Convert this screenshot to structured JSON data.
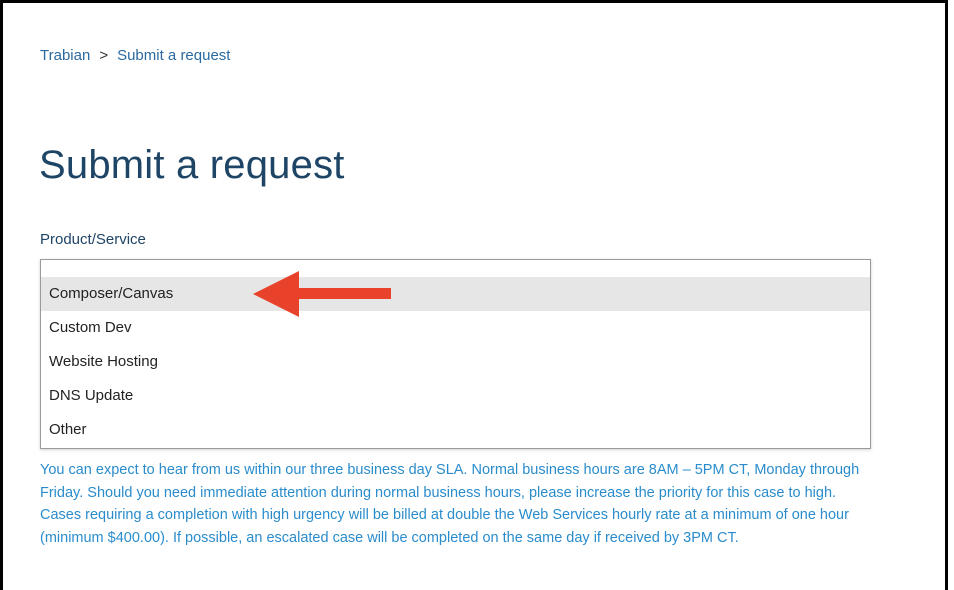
{
  "breadcrumb": {
    "root": "Trabian",
    "separator": ">",
    "current": "Submit a request"
  },
  "page": {
    "title": "Submit a request"
  },
  "form": {
    "product_label": "Product/Service",
    "product_options": [
      "Composer/Canvas",
      "Custom Dev",
      "Website Hosting",
      "DNS Update",
      "Other"
    ],
    "highlighted_option": "Composer/Canvas",
    "help_text": "You can expect to hear from us within our three business day SLA. Normal business hours are 8AM – 5PM CT, Monday through Friday. Should you need immediate attention during normal business hours, please increase the priority for this case to high. Cases requiring a completion with high urgency will be billed at double the Web Services hourly rate at a minimum of one hour (minimum $400.00). If possible, an escalated case will be completed on the same day if received by 3PM CT."
  },
  "annotation": {
    "icon": "red-arrow-icon",
    "color": "#e8432a"
  },
  "colors": {
    "link": "#2a6aa0",
    "title": "#1e4466",
    "help_text": "#2a8ccc",
    "highlight": "#e6e6e6"
  }
}
